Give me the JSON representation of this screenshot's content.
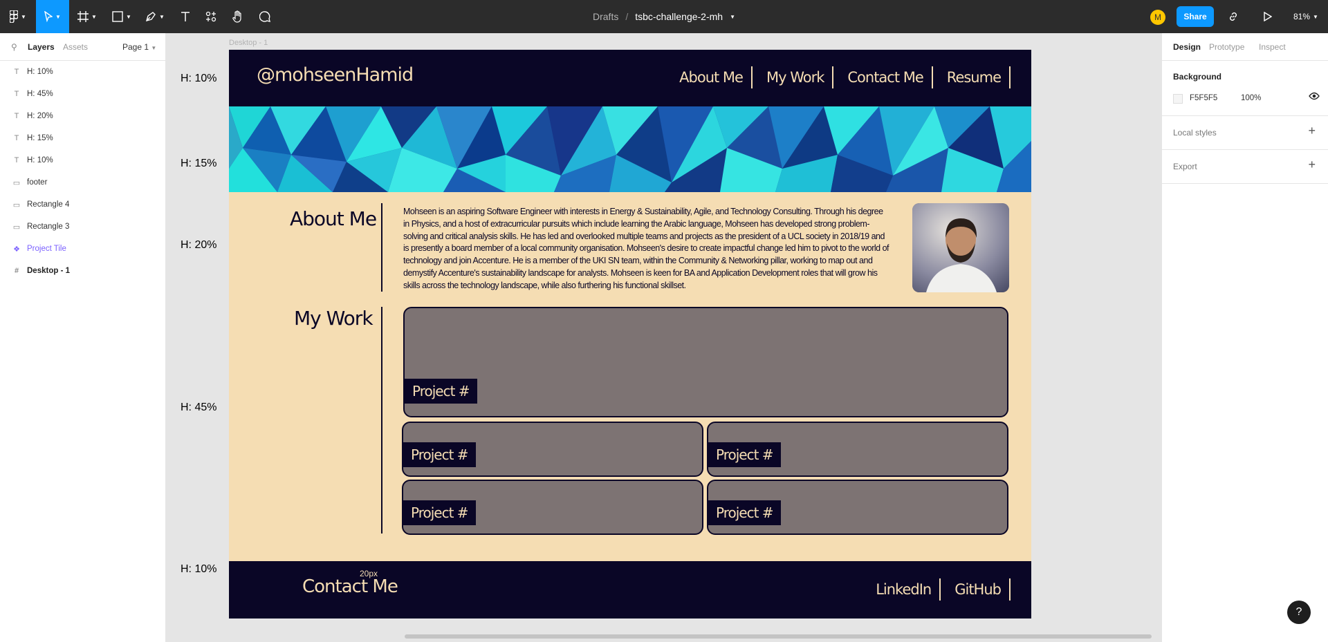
{
  "toolbar": {
    "breadcrumb_drafts": "Drafts",
    "breadcrumb_sep": "/",
    "file_name": "tsbc-challenge-2-mh",
    "avatar_initial": "M",
    "share_label": "Share",
    "zoom": "81%",
    "accent_color": "#0d99ff"
  },
  "left_panel": {
    "tab_layers": "Layers",
    "tab_assets": "Assets",
    "page": "Page 1",
    "layers": [
      {
        "label": "H: 10%",
        "icon": "text-icon"
      },
      {
        "label": "H: 45%",
        "icon": "text-icon"
      },
      {
        "label": "H: 20%",
        "icon": "text-icon"
      },
      {
        "label": "H: 15%",
        "icon": "text-icon"
      },
      {
        "label": "H: 10%",
        "icon": "text-icon"
      },
      {
        "label": "footer",
        "icon": "rectangle-icon"
      },
      {
        "label": "Rectangle 4",
        "icon": "rectangle-icon"
      },
      {
        "label": "Rectangle 3",
        "icon": "rectangle-icon"
      },
      {
        "label": "Project Tile",
        "icon": "component-icon"
      },
      {
        "label": "Desktop - 1",
        "icon": "frame-icon"
      }
    ]
  },
  "canvas": {
    "frame_label": "Desktop - 1",
    "height_labels": [
      "H: 10%",
      "H: 15%",
      "H: 20%",
      "H: 45%",
      "H: 10%"
    ],
    "site": {
      "handle": "@mohseenHamid",
      "nav": [
        "About Me",
        "My Work",
        "Contact Me",
        "Resume"
      ],
      "about_title": "About Me",
      "about_text": "Mohseen is an aspiring Software Engineer with interests in Energy & Sustainability, Agile, and Technology Consulting. Through his degree in Physics, and a host of extracurricular pursuits which include learning the Arabic language, Mohseen has developed strong problem-solving and critical analysis skills. He has led and overlooked multiple teams and projects as the president of a UCL society in 2018/19 and is presently a board member of a local community organisation. Mohseen's desire to create impactful change led him to pivot to the world of technology and join Accenture. He is a member of the UKI SN team, within the Community & Networking pillar, working to map out and demystify Accenture's sustainability landscape for analysts. Mohseen is keen for BA and Application Development roles that will grow his skills across the technology landscape, while also furthering his functional skillset.",
      "work_title": "My Work",
      "project_label": "Project #",
      "footer_px_note": "20px",
      "footer_contact": "Contact Me",
      "footer_links": [
        "LinkedIn",
        "GitHub"
      ],
      "colors": {
        "navy": "#0a0626",
        "cream": "#f5ddb3",
        "tile": "#7d7373"
      }
    }
  },
  "right_panel": {
    "tab_design": "Design",
    "tab_prototype": "Prototype",
    "tab_inspect": "Inspect",
    "background_title": "Background",
    "background_hex": "F5F5F5",
    "background_opacity": "100%",
    "local_styles": "Local styles",
    "export": "Export"
  },
  "help_label": "?"
}
